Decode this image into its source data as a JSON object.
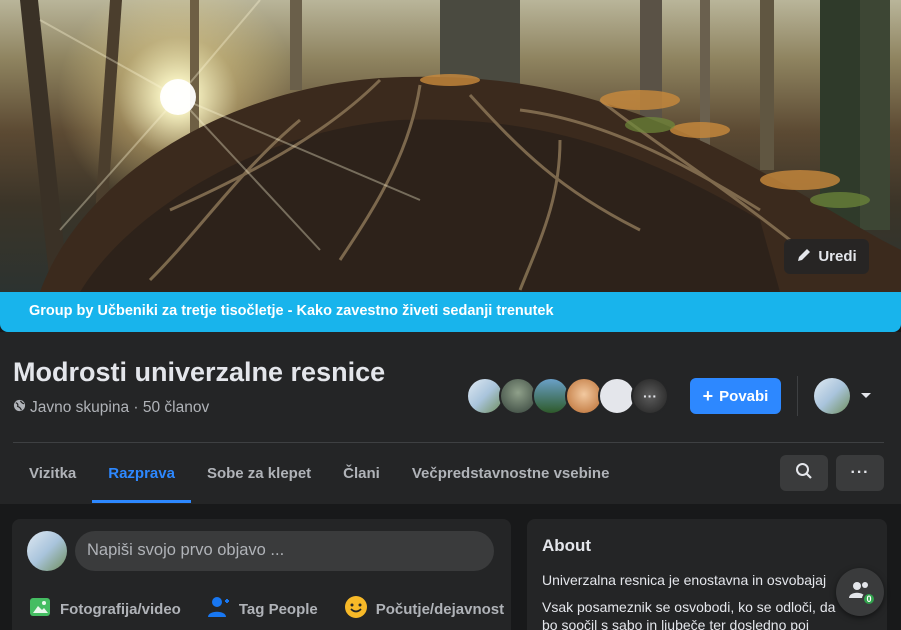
{
  "cover": {
    "edit_label": "Uredi"
  },
  "banner": {
    "text": "Group by Učbeniki za tretje tisočletje - Kako zavestno živeti sedanji trenutek"
  },
  "group": {
    "title": "Modrosti univerzalne resnice",
    "meta": "Javno skupina · 50 članov",
    "join_label": "Povabi"
  },
  "tabs": [
    "Vizitka",
    "Razprava",
    "Sobe za klepet",
    "Člani",
    "Večpredstavnostne vsebine"
  ],
  "active_tab": "Razprava",
  "composer": {
    "placeholder": "Napiši svojo prvo objavo ...",
    "actions": [
      "Fotografija/video",
      "Tag People",
      "Počutje/dejavnost"
    ]
  },
  "about": {
    "title": "About",
    "line1": "Univerzalna resnica je enostavna in osvobajaj",
    "line2": "Vsak posameznik se osvobodi, ko se odloči, da",
    "line3": "bo soočil s sabo in ljubeče ter dosledno poj"
  },
  "float_badge": "0",
  "colors": {
    "accent": "#2d88ff",
    "banner": "#18b4ec",
    "background": "#18191a",
    "card": "#242526"
  }
}
